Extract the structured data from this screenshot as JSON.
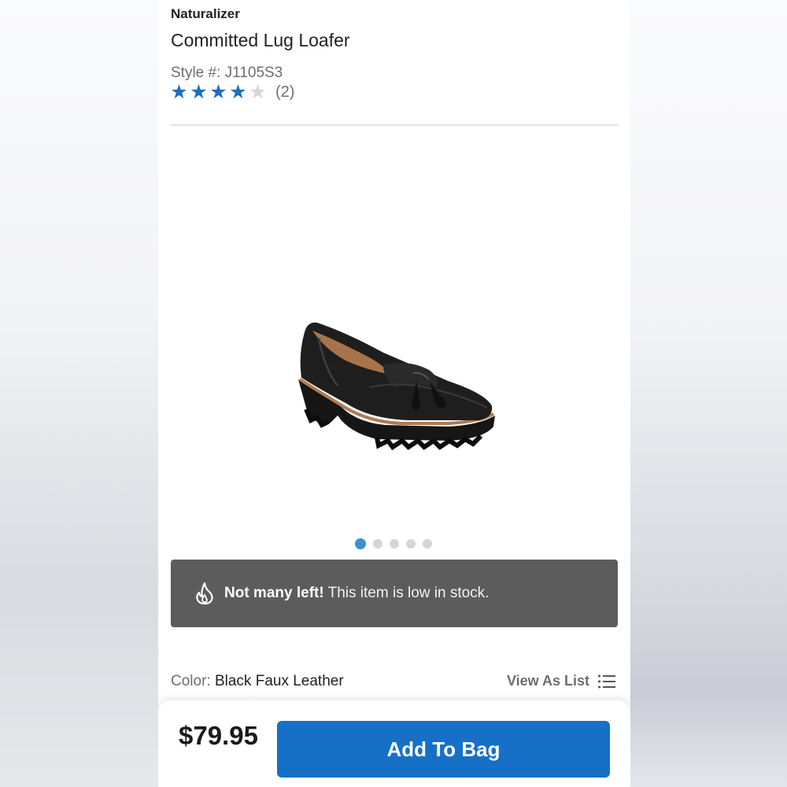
{
  "product": {
    "brand": "Naturalizer",
    "name": "Committed Lug Loafer",
    "style_label": "Style #:",
    "style_number": "J1105S3",
    "rating": 4,
    "rating_max": 5,
    "review_count": "(2)"
  },
  "gallery": {
    "image_icon": "black-lug-loafer-image",
    "dot_count": 5,
    "active_index": 0
  },
  "stock_alert": {
    "icon": "flame-icon",
    "title": "Not many left!",
    "message": "This item is low in stock."
  },
  "color": {
    "label": "Color:",
    "value": "Black Faux Leather"
  },
  "view_as_list": {
    "label": "View As List",
    "icon": "list-icon"
  },
  "purchase": {
    "price": "$79.95",
    "button_label": "Add To Bag"
  },
  "colors": {
    "accent": "#1670c6",
    "star": "#1b6fc2",
    "banner": "#5c5c5c",
    "active_dot": "#3f8fd1"
  }
}
